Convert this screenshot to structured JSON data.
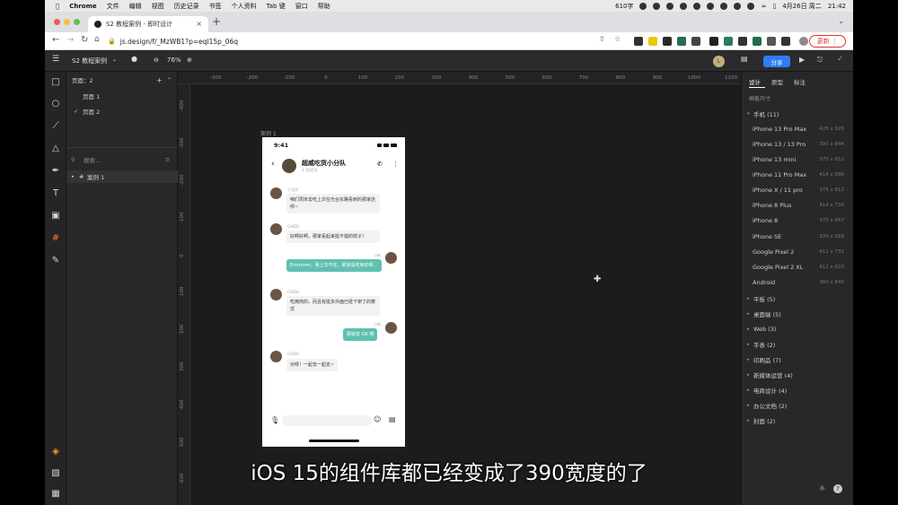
{
  "menubar": {
    "app": "Chrome",
    "items": [
      "文件",
      "编辑",
      "视图",
      "历史记录",
      "书签",
      "个人资料",
      "Tab 键",
      "窗口",
      "帮助"
    ],
    "wordcount": "610字",
    "datetime": "4月26日 周二",
    "time": "21:42"
  },
  "browser": {
    "tab_title": "S2 教程案例 - 即时设计",
    "url": "js.design/f/_MzWB1?p=eql15p_06q",
    "update_label": "更新"
  },
  "app": {
    "file_name": "S2 教程案例",
    "zoom": "76%",
    "user_initial": "L",
    "share_label": "分享"
  },
  "layers": {
    "pages_header": "页面：2",
    "pages": [
      "页面 1",
      "页面 2"
    ],
    "search_placeholder": "搜索...",
    "frames": [
      "案例 1"
    ]
  },
  "canvas": {
    "artboard_label": "案例 1",
    "ruler_top": [
      "-300",
      "-200",
      "-100",
      "0",
      "100",
      "200",
      "300",
      "400",
      "500",
      "600",
      "700",
      "800",
      "900",
      "1000",
      "1100"
    ],
    "ruler_left": [
      "-400",
      "-300",
      "-200",
      "-100",
      "0",
      "100",
      "200",
      "300",
      "400",
      "500",
      "600"
    ]
  },
  "phone": {
    "time": "9:41",
    "chat_title": "超威吃货小分队",
    "chat_sub": "4 位成员",
    "messages": [
      {
        "side": "left",
        "name": "小龙哥",
        "text": "咱们周末去吃上次在光台东路看到的那家店呗~"
      },
      {
        "side": "left",
        "name": "CHIDO",
        "text": "好啊好啊，那家看起来挺不错的样子！"
      },
      {
        "side": "right",
        "name": "小新",
        "text": "Emmmm，我上次不在，那家是吃啥的呀..."
      },
      {
        "side": "left",
        "name": "CHIDO",
        "text": "吃烤肉的，而且有挺多外面已经下架了的菜式"
      },
      {
        "side": "right",
        "name": "小新",
        "text": "那就去 OK 哦"
      },
      {
        "side": "left",
        "name": "CHIDO",
        "text": "对呀！一起去一起去~"
      }
    ]
  },
  "props": {
    "tabs": [
      "设计",
      "原型",
      "标注"
    ],
    "section_label": "画板尺寸",
    "open_group": "手机 (11)",
    "devices": [
      {
        "name": "iPhone 13 Pro Max",
        "size": "428 x 926"
      },
      {
        "name": "iPhone 13 / 13 Pro",
        "size": "390 x 844"
      },
      {
        "name": "iPhone 13 mini",
        "size": "375 x 812"
      },
      {
        "name": "iPhone 11 Pro Max",
        "size": "414 x 896"
      },
      {
        "name": "iPhone X / 11 pro",
        "size": "375 x 812"
      },
      {
        "name": "iPhone 8 Plus",
        "size": "414 x 736"
      },
      {
        "name": "iPhone 8",
        "size": "375 x 667"
      },
      {
        "name": "iPhone SE",
        "size": "320 x 568"
      },
      {
        "name": "Google Pixel 2",
        "size": "411 x 731"
      },
      {
        "name": "Google Pixel 2 XL",
        "size": "411 x 823"
      },
      {
        "name": "Android",
        "size": "360 x 640"
      }
    ],
    "groups": [
      "平板 (5)",
      "桌面端 (5)",
      "Web (3)",
      "手表 (2)",
      "印刷品 (7)",
      "新媒体运营 (4)",
      "电商设计 (4)",
      "办公文档 (2)",
      "封面 (2)"
    ]
  },
  "caption": "iOS 15的组件库都已经变成了390宽度的了",
  "colors": {
    "accent": "#2e7df6",
    "bubble_right": "#5fc0b0",
    "update_red": "#d33333"
  }
}
